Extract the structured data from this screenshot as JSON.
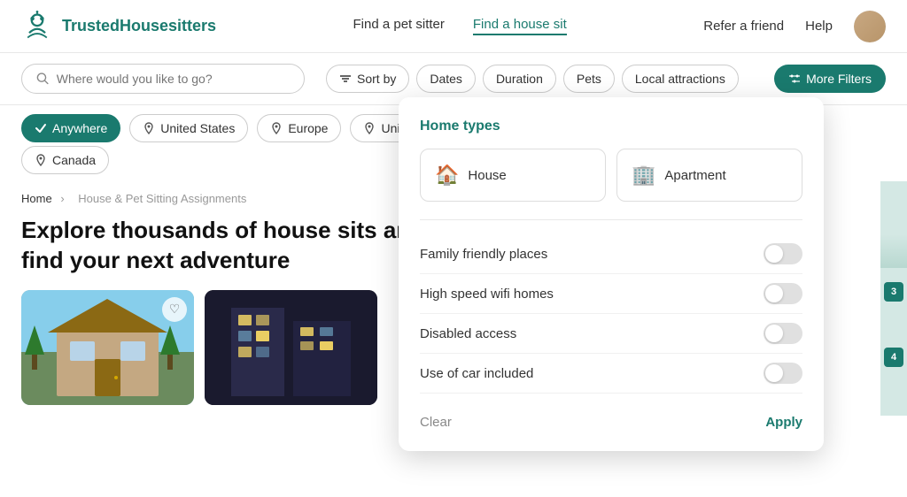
{
  "header": {
    "logo_text": "TrustedHousesitters",
    "nav": [
      {
        "label": "Find a pet sitter",
        "active": false
      },
      {
        "label": "Find a house sit",
        "active": true
      }
    ],
    "right": {
      "refer": "Refer a friend",
      "help": "Help"
    }
  },
  "filter_bar": {
    "search_placeholder": "Where would you like to go?",
    "buttons": [
      {
        "label": "Sort by",
        "icon": "sort",
        "active": false
      },
      {
        "label": "Dates",
        "active": false
      },
      {
        "label": "Duration",
        "active": false
      },
      {
        "label": "Pets",
        "active": false
      },
      {
        "label": "Local attractions",
        "active": false
      }
    ],
    "more_filters": "More Filters"
  },
  "location_chips_row1": [
    {
      "label": "Anywhere",
      "selected": true
    },
    {
      "label": "United States",
      "selected": false
    },
    {
      "label": "Europe",
      "selected": false
    },
    {
      "label": "United Kingdom",
      "selected": false
    }
  ],
  "location_chips_row2": [
    {
      "label": "Canada",
      "selected": false
    }
  ],
  "breadcrumb": {
    "home": "Home",
    "separator": "›",
    "current": "House & Pet Sitting Assignments"
  },
  "headline": "Explore thousands of house sits and find your next adventure",
  "dropdown": {
    "title": "Home types",
    "home_types": [
      {
        "label": "House",
        "icon": "🏠"
      },
      {
        "label": "Apartment",
        "icon": "🏢"
      }
    ],
    "toggles": [
      {
        "label": "Family friendly places",
        "on": false
      },
      {
        "label": "High speed wifi homes",
        "on": false
      },
      {
        "label": "Disabled access",
        "on": false
      },
      {
        "label": "Use of car included",
        "on": false
      }
    ],
    "clear_label": "Clear",
    "apply_label": "Apply"
  },
  "map_badges": [
    "3",
    "4"
  ],
  "colors": {
    "brand": "#1a7a6e",
    "brand_light": "#d4e8e4"
  }
}
